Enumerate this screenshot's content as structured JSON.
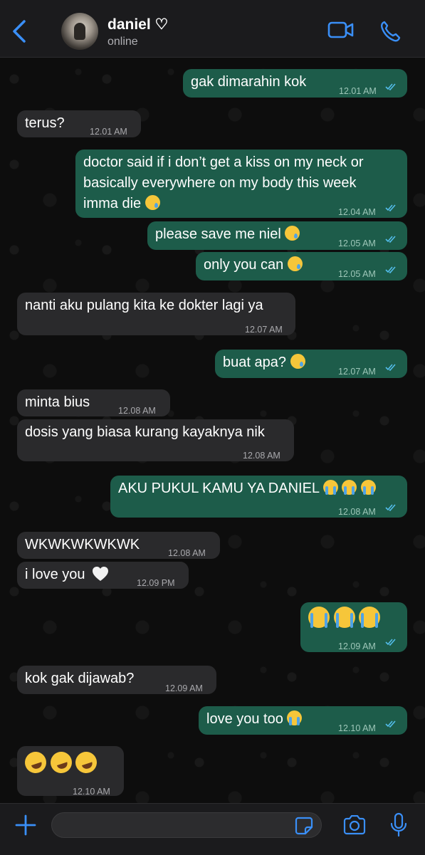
{
  "header": {
    "contact_name": "daniel ♡",
    "status": "online"
  },
  "colors": {
    "accent": "#3a8ff7",
    "outgoing_bubble": "#1d5c4a",
    "incoming_bubble": "#2a2a2c",
    "read_ticks": "#53bdeb"
  },
  "messages": [
    {
      "dir": "out",
      "text": "gak dimarahin kok",
      "time": "12.01 AM"
    },
    {
      "dir": "in",
      "text": "terus?",
      "time": "12.01 AM"
    },
    {
      "dir": "out",
      "text_line1": "doctor said if i don’t get a kiss on my neck or",
      "text_line2": "basically everywhere on my body this week",
      "text_line3": "imma die",
      "emoji": "crying-face",
      "time": "12.04 AM"
    },
    {
      "dir": "out",
      "text": "please save me niel",
      "emoji": "crying-face",
      "time": "12.05 AM"
    },
    {
      "dir": "out",
      "text": "only you can",
      "emoji": "crying-face",
      "time": "12.05 AM"
    },
    {
      "dir": "in",
      "text": "nanti aku pulang kita ke dokter lagi ya",
      "time": "12.07 AM"
    },
    {
      "dir": "out",
      "text": "buat apa?",
      "emoji": "crying-face",
      "time": "12.07 AM"
    },
    {
      "dir": "in",
      "text": "minta bius",
      "time": "12.08 AM"
    },
    {
      "dir": "in",
      "text": "dosis yang biasa kurang kayaknya nik",
      "time": "12.08 AM"
    },
    {
      "dir": "out",
      "text": "AKU PUKUL KAMU YA DANIEL",
      "emoji": "loudly-crying-face x3",
      "time": "12.08 AM"
    },
    {
      "dir": "in",
      "text": "WKWKWKWKWK",
      "time": "12.08 AM"
    },
    {
      "dir": "in",
      "text": "i love you",
      "emoji": "white-heart",
      "time": "12.09 PM"
    },
    {
      "dir": "out",
      "emoji": "loudly-crying-face x3",
      "time": "12.09 AM"
    },
    {
      "dir": "in",
      "text": "kok gak dijawab?",
      "time": "12.09 AM"
    },
    {
      "dir": "out",
      "text": "love you too",
      "emoji": "loudly-crying-face",
      "time": "12.10 AM"
    },
    {
      "dir": "in",
      "emoji": "rolling-on-floor-laughing x3",
      "time": "12.10 AM"
    }
  ],
  "input": {
    "placeholder": "",
    "value": ""
  },
  "icons": {
    "back": "chevron-left-icon",
    "video": "video-camera-icon",
    "call": "phone-icon",
    "add": "plus-icon",
    "sticker": "sticker-icon",
    "camera": "camera-icon",
    "mic": "microphone-icon"
  }
}
